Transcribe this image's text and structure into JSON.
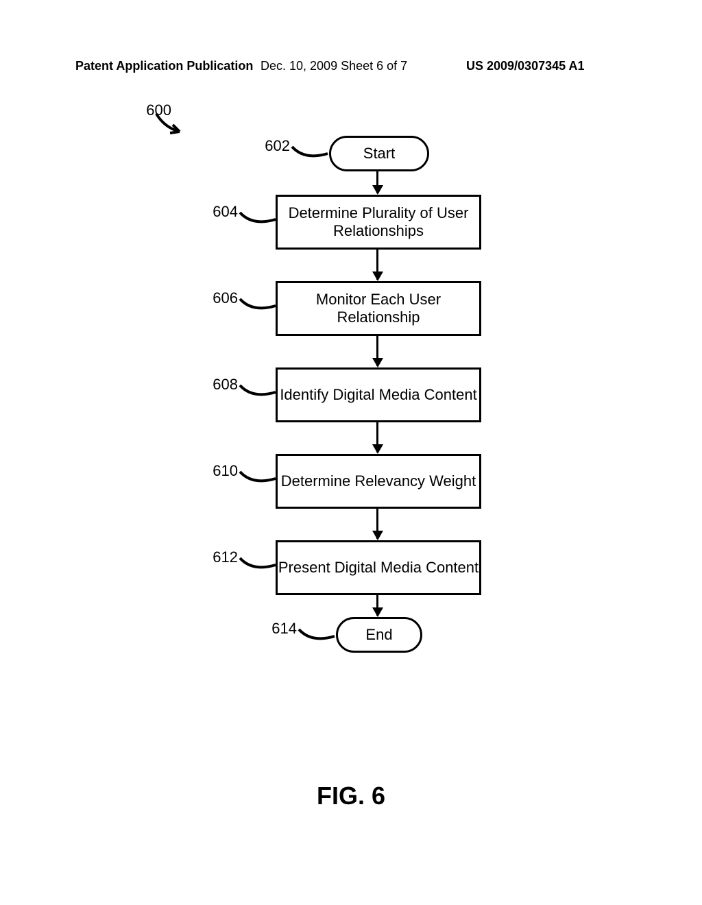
{
  "header": {
    "left": "Patent Application Publication",
    "center": "Dec. 10, 2009  Sheet 6 of 7",
    "right": "US 2009/0307345 A1"
  },
  "figure_label": "FIG. 6",
  "main_ref": "600",
  "steps": [
    {
      "ref": "602",
      "text": "Start",
      "type": "terminator"
    },
    {
      "ref": "604",
      "text": "Determine Plurality of User\nRelationships",
      "type": "process"
    },
    {
      "ref": "606",
      "text": "Monitor Each User Relationship",
      "type": "process"
    },
    {
      "ref": "608",
      "text": "Identify Digital Media Content",
      "type": "process"
    },
    {
      "ref": "610",
      "text": "Determine Relevancy Weight",
      "type": "process"
    },
    {
      "ref": "612",
      "text": "Present Digital Media Content",
      "type": "process"
    },
    {
      "ref": "614",
      "text": "End",
      "type": "terminator"
    }
  ]
}
